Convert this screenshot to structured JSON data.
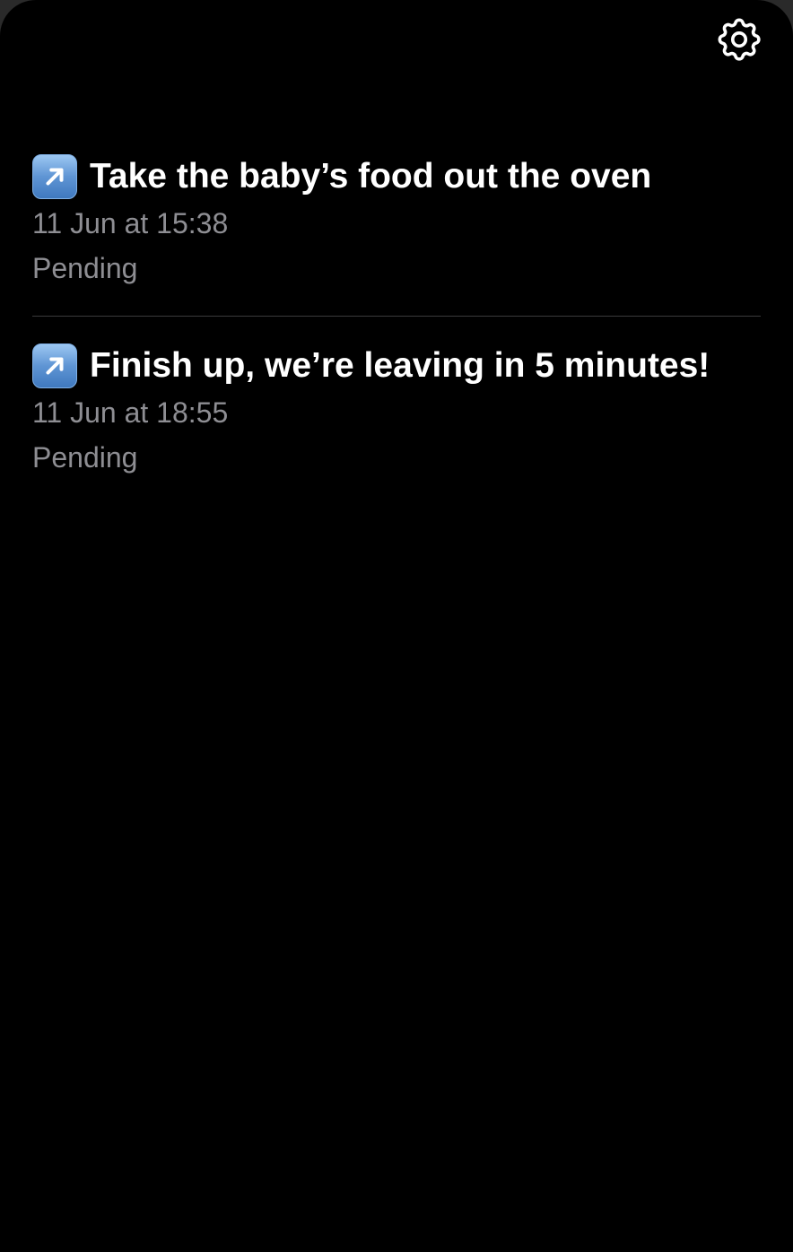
{
  "header": {
    "settings_icon": "gear-icon"
  },
  "items": [
    {
      "icon": "up-right-arrow-icon",
      "title": "Take the baby’s food out the oven",
      "datetime": "11 Jun at 15:38",
      "status": "Pending"
    },
    {
      "icon": "up-right-arrow-icon",
      "title": "Finish up, we’re leaving in 5 minutes!",
      "datetime": "11 Jun at 18:55",
      "status": "Pending"
    }
  ],
  "colors": {
    "background": "#000000",
    "title": "#ffffff",
    "secondary_text": "#8e8e93",
    "divider": "#3a3a3c",
    "badge": "#5f95d4"
  }
}
